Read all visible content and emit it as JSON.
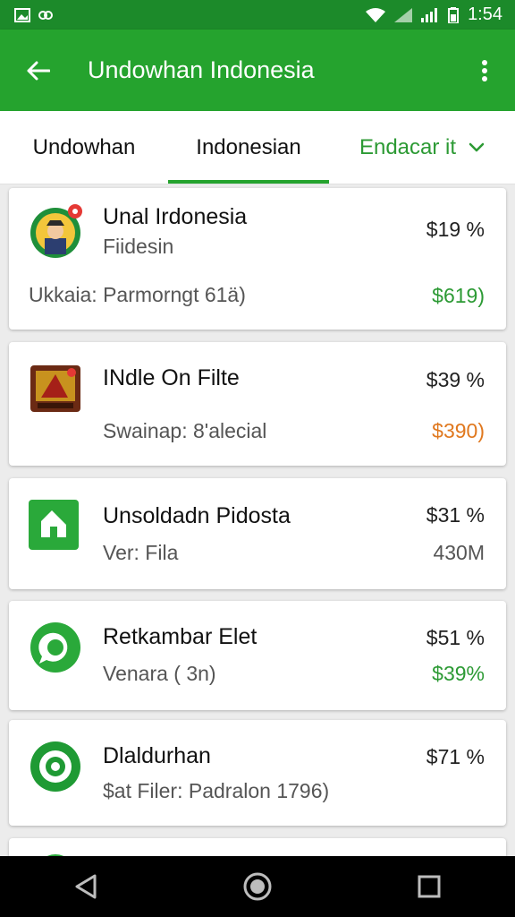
{
  "status_bar": {
    "time": "1:54"
  },
  "app_bar": {
    "title": "Undowhan Indonesia"
  },
  "tabs": [
    {
      "label": "Undowhan"
    },
    {
      "label": "Indonesian"
    },
    {
      "label": "Endacar it"
    }
  ],
  "items": [
    {
      "title": "Unal Irdonesia",
      "subtitle": "Fiidesin",
      "detail": "Ukkaia: Parmorngt 61ä)",
      "price": "$19 %",
      "value": "$619)",
      "value_color": "#2c9a34"
    },
    {
      "title": "INdle On Filte",
      "detail": "Swainap: 8'alecial",
      "price": "$39 %",
      "value": "$390)",
      "value_color": "#e0781e"
    },
    {
      "title": "Unsoldadn Pidosta",
      "subtitle": "Ver: Fila",
      "price": "$31 %",
      "value": "430M",
      "value_color": "#555555"
    },
    {
      "title": "Retkambar Elet",
      "subtitle": "Venara ( 3n)",
      "price": "$51 %",
      "value": "$39%",
      "value_color": "#2c9a34"
    },
    {
      "title": "Dlaldurhan",
      "subtitle": "$at Filer: Padralon 1796)",
      "price": "$71 %"
    }
  ],
  "colors": {
    "primary": "#25a32e",
    "status_bar": "#1c8a2a",
    "accent_green": "#2c9a34",
    "accent_orange": "#e0781e"
  }
}
